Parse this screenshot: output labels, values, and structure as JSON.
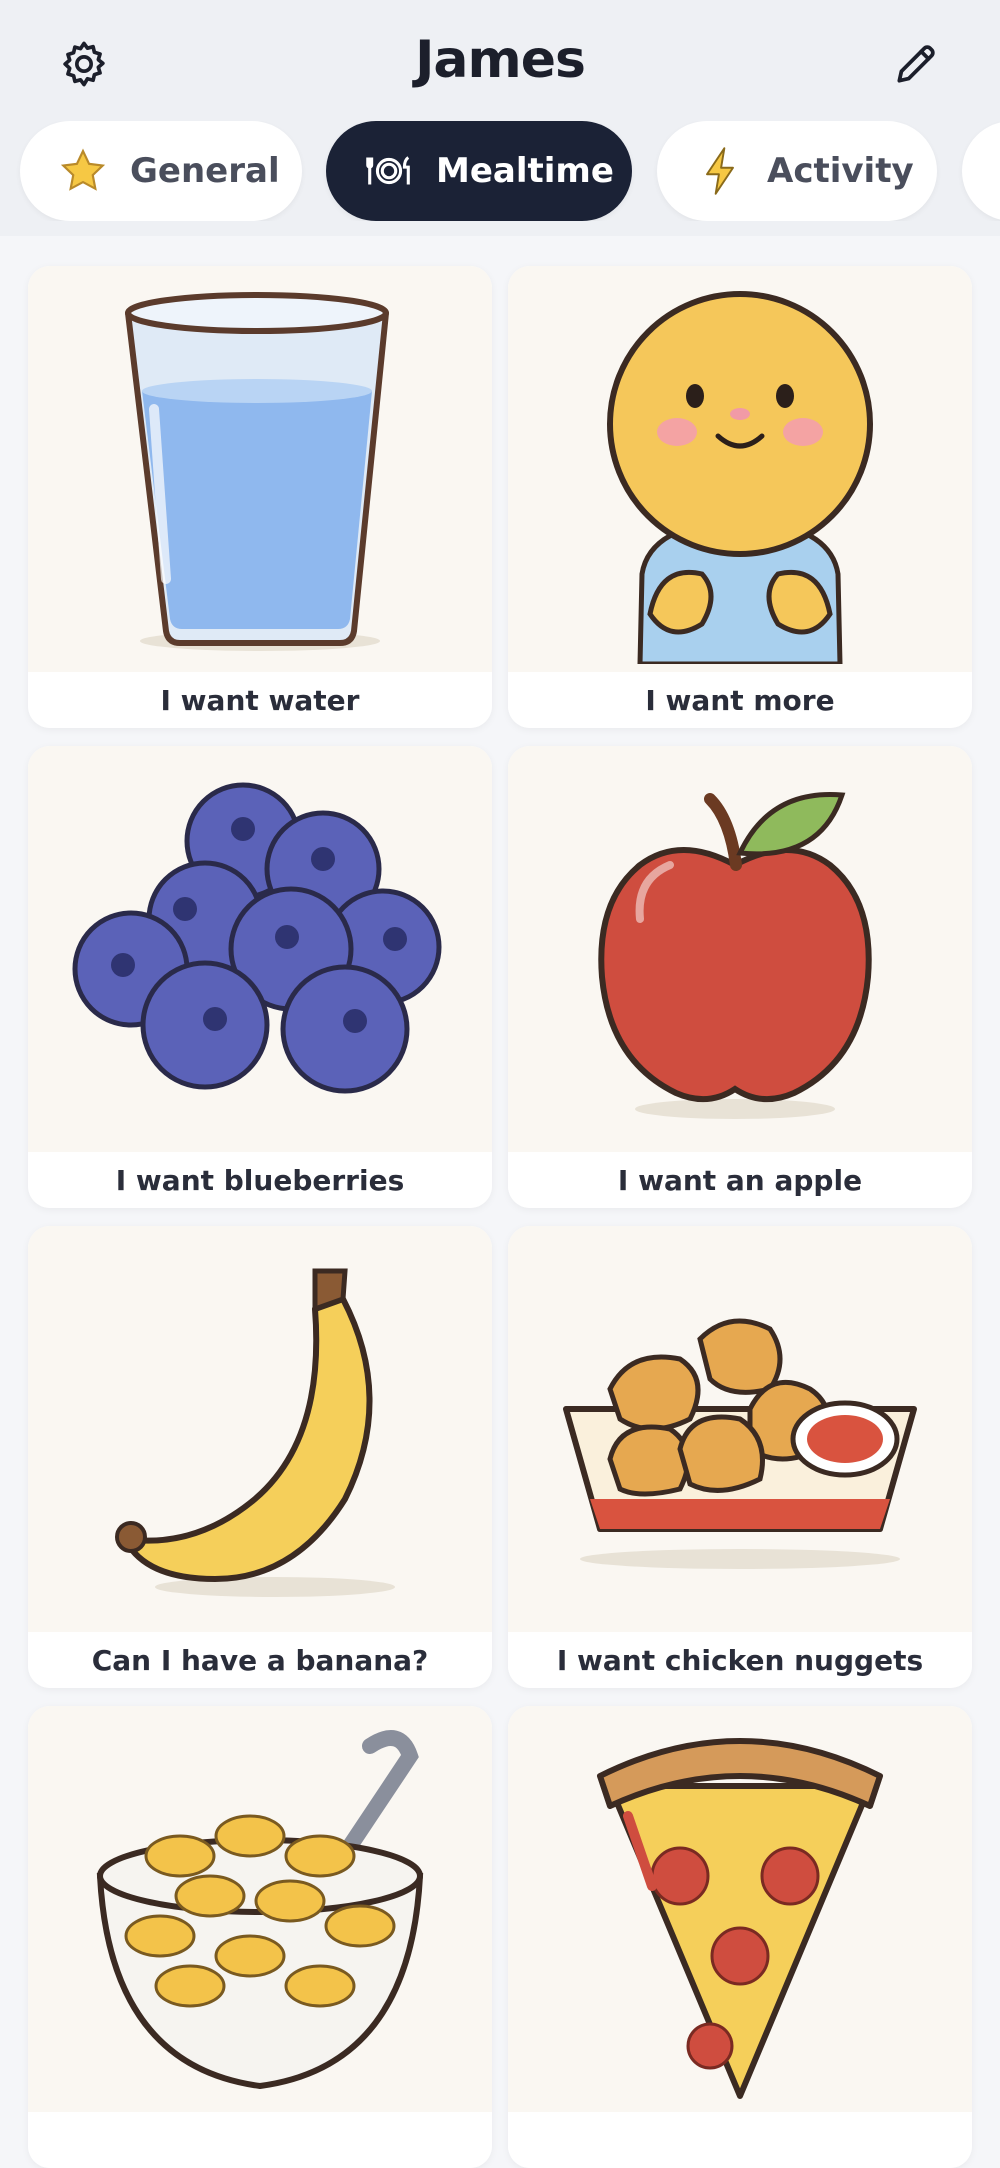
{
  "header": {
    "title": "James",
    "settings_icon": "gear-icon",
    "edit_icon": "pencil-icon"
  },
  "tabs": [
    {
      "label": "General",
      "icon": "star-icon",
      "active": false
    },
    {
      "label": "Mealtime",
      "icon": "plate-cutlery-icon",
      "active": true
    },
    {
      "label": "Activity",
      "icon": "lightning-icon",
      "active": false
    }
  ],
  "cards": [
    {
      "label": "I want water",
      "image": "glass-of-water"
    },
    {
      "label": "I want more",
      "image": "child-signing-more"
    },
    {
      "label": "I want blueberries",
      "image": "blueberries"
    },
    {
      "label": "I want an apple",
      "image": "apple"
    },
    {
      "label": "Can I have a banana?",
      "image": "banana"
    },
    {
      "label": "I want chicken nuggets",
      "image": "chicken-nuggets"
    },
    {
      "label": "",
      "image": "mac-and-cheese"
    },
    {
      "label": "",
      "image": "pizza-slice"
    }
  ],
  "colors": {
    "accent_dark": "#1b2236",
    "card_bg": "#ffffff",
    "page_bg": "#f5f6f9"
  }
}
